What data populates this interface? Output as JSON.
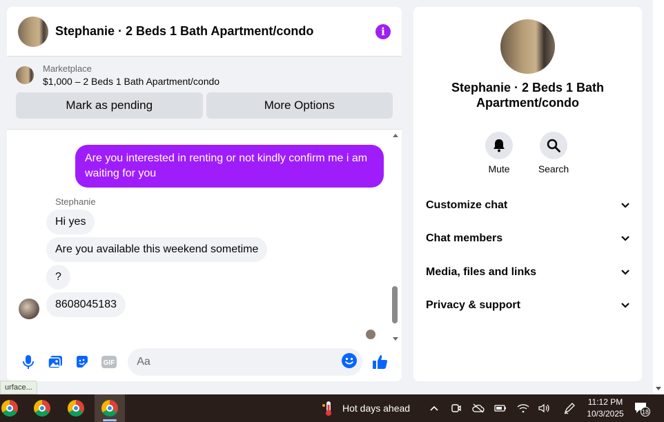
{
  "chat": {
    "title": "Stephanie · 2 Beds 1 Bath Apartment/condo",
    "marketplace": {
      "label": "Marketplace",
      "listing": "$1,000 – 2 Beds 1 Bath Apartment/condo",
      "pending_button": "Mark as pending",
      "options_button": "More Options"
    },
    "messages": {
      "outgoing": "Are you interested in renting or not kindly confirm me i am waiting for you",
      "sender": "Stephanie",
      "incoming": [
        "Hi yes",
        "Are you available this weekend sometime",
        "?",
        "8608045183"
      ]
    },
    "composer": {
      "placeholder": "Aa",
      "gif_label": "GIF"
    }
  },
  "info_panel": {
    "title": "Stephanie · 2 Beds 1 Bath Apartment/condo",
    "actions": {
      "mute": "Mute",
      "search": "Search"
    },
    "sections": [
      "Customize chat",
      "Chat members",
      "Media, files and links",
      "Privacy & support"
    ]
  },
  "status_tip": "urface...",
  "taskbar": {
    "weather": "Hot days ahead",
    "time": "11:12 PM",
    "date": "10/3/2025",
    "notification_count": "18"
  },
  "colors": {
    "accent": "#9f1dfa",
    "messenger_blue": "#0866ff",
    "info_icon": "#a020f0"
  }
}
